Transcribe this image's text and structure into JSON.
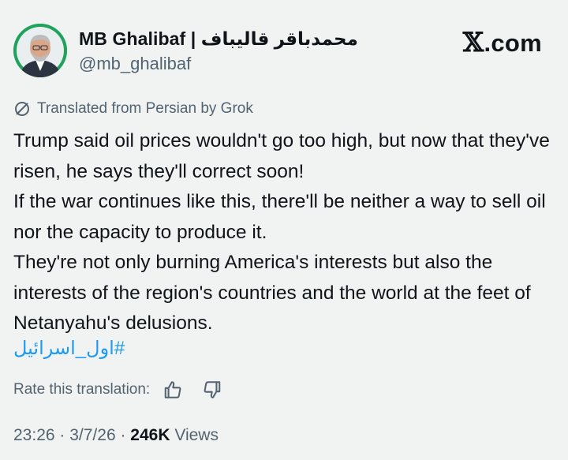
{
  "author": {
    "display_name": "MB Ghalibaf | محمدباقر قالیباف",
    "handle": "@mb_ghalibaf"
  },
  "brand": {
    "x_glyph": "𝕏",
    "domain": ".com"
  },
  "translation": {
    "notice": "Translated from Persian by Grok",
    "icon": "grok-icon"
  },
  "tweet": {
    "paragraphs": [
      "Trump said oil prices wouldn't go too high, but now that they've risen, he says they'll correct soon!",
      "If the war continues like this, there'll be neither a way to sell oil nor the capacity to produce it.",
      "They're not only burning America's interests but also the interests of the region's countries and the world at the feet of Netanyahu's delusions."
    ],
    "hashtag": "#اول_اسرائیل"
  },
  "rating": {
    "label": "Rate this translation:",
    "up_icon": "thumbs-up-icon",
    "down_icon": "thumbs-down-icon"
  },
  "meta": {
    "time": "23:26",
    "sep1": " · ",
    "date": "3/7/26",
    "sep2": " · ",
    "views_count": "246K",
    "views_label": " Views"
  },
  "colors": {
    "background": "#f1f2f2",
    "text": "#0f1419",
    "secondary": "#536471",
    "link": "#1d9bf0",
    "avatar_ring": "#1fa35a"
  }
}
